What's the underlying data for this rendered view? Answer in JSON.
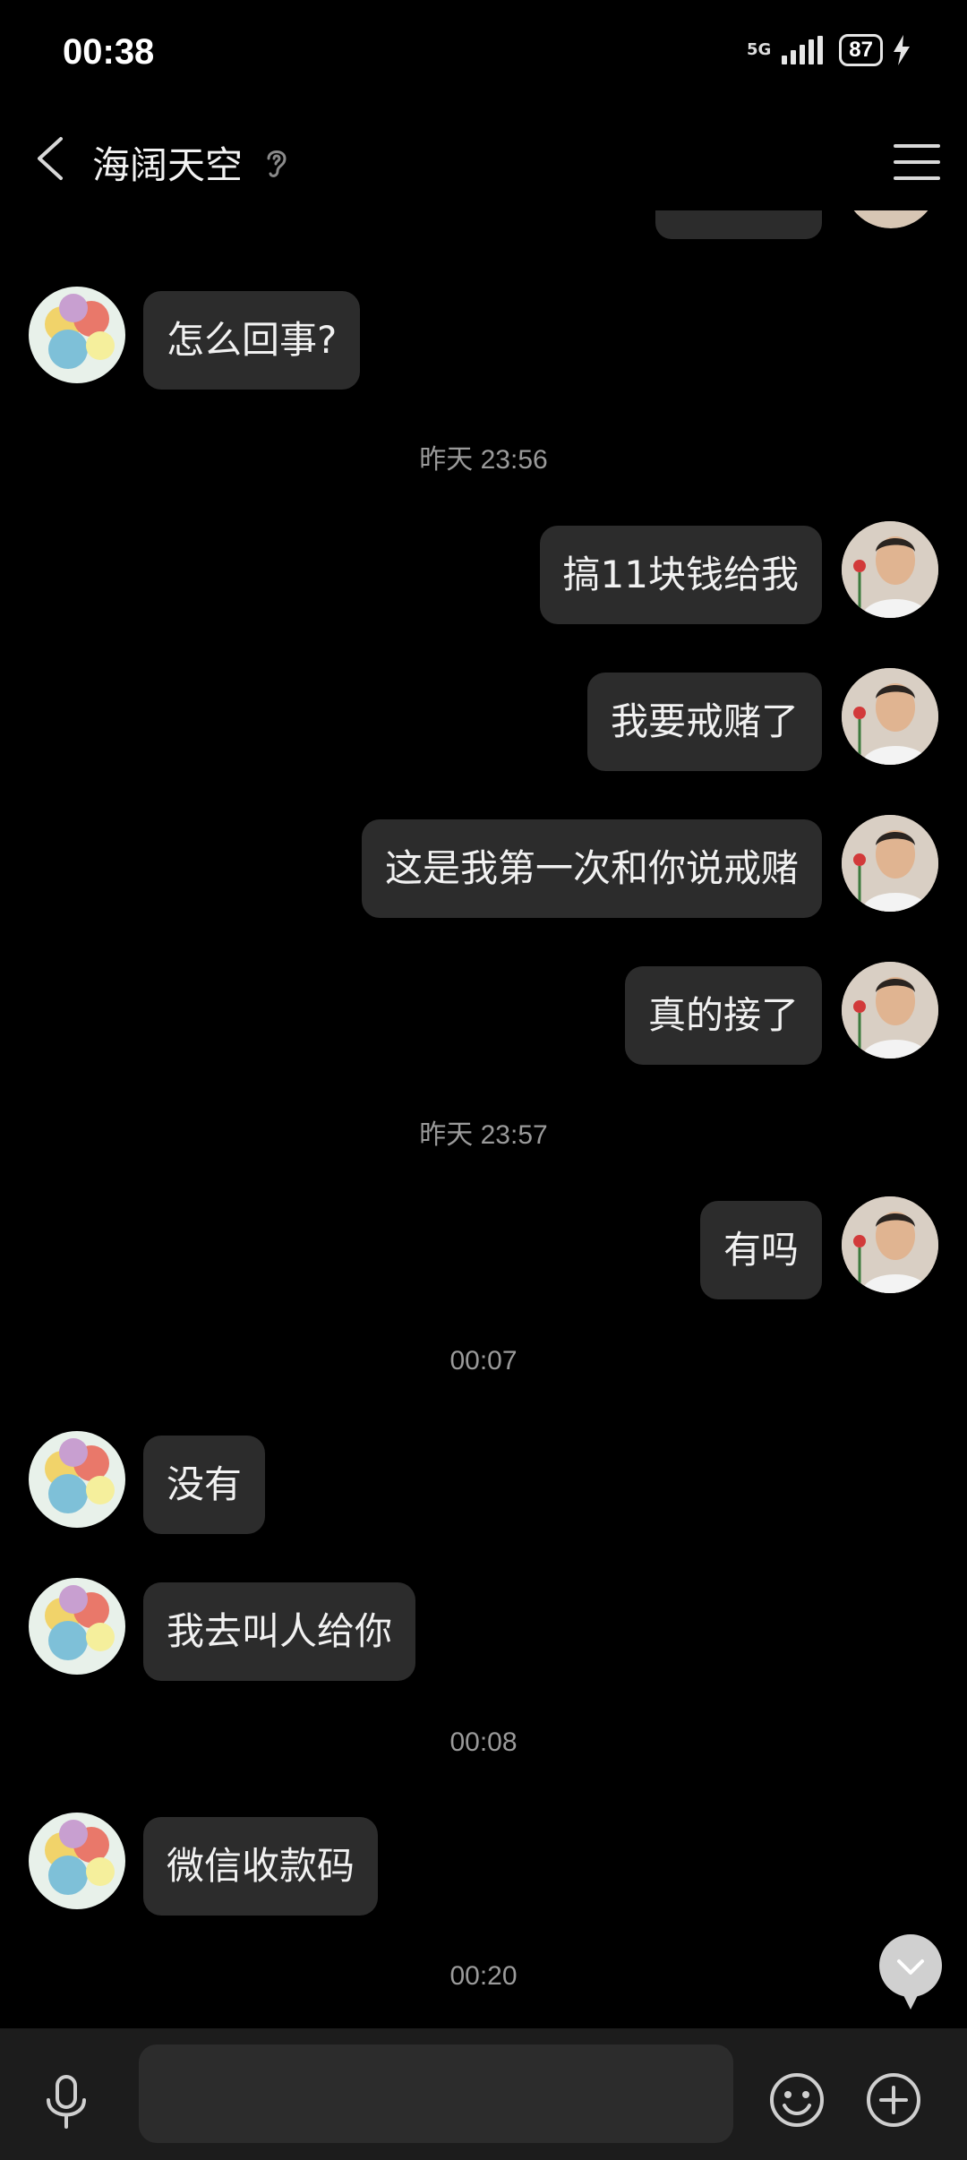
{
  "status_bar": {
    "time": "00:38",
    "network": "5G",
    "battery": "87"
  },
  "header": {
    "title": "海阔天空"
  },
  "messages": [
    {
      "side": "left",
      "text": "怎么回事?"
    },
    {
      "type": "time",
      "text": "昨天 23:56"
    },
    {
      "side": "right",
      "text": "搞11块钱给我"
    },
    {
      "side": "right",
      "text": "我要戒赌了"
    },
    {
      "side": "right",
      "text": "这是我第一次和你说戒赌"
    },
    {
      "side": "right",
      "text": "真的接了"
    },
    {
      "type": "time",
      "text": "昨天 23:57"
    },
    {
      "side": "right",
      "text": "有吗"
    },
    {
      "type": "time",
      "text": "00:07"
    },
    {
      "side": "left",
      "text": "没有"
    },
    {
      "side": "left",
      "text": "我去叫人给你"
    },
    {
      "type": "time",
      "text": "00:08"
    },
    {
      "side": "left",
      "text": "微信收款码"
    },
    {
      "type": "time",
      "text": "00:20"
    }
  ],
  "input_bar": {
    "placeholder": ""
  }
}
